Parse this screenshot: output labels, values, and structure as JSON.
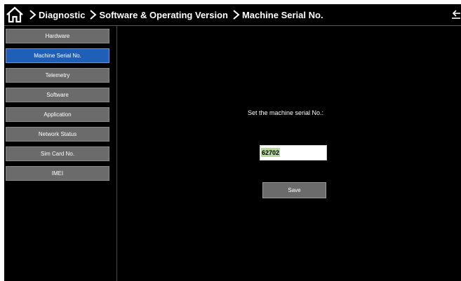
{
  "header": {
    "breadcrumb": [
      "Diagnostic",
      "Software & Operating Version",
      "Machine Serial No."
    ],
    "home_icon": "home-icon",
    "separator_icon": "chevron-right-icon",
    "back_icon": "back-arrow-icon"
  },
  "sidebar": {
    "items": [
      {
        "label": "Hardware",
        "active": false
      },
      {
        "label": "Machine Serial No.",
        "active": true
      },
      {
        "label": "Telemetry",
        "active": false
      },
      {
        "label": "Software",
        "active": false
      },
      {
        "label": "Application",
        "active": false
      },
      {
        "label": "Network Status",
        "active": false
      },
      {
        "label": "Sim Card No.",
        "active": false
      },
      {
        "label": "IMEI",
        "active": false
      }
    ]
  },
  "main": {
    "prompt": "Set the machine serial No.:",
    "serial_value": "62702",
    "save_label": "Save"
  },
  "colors": {
    "background": "#000000",
    "button": "#6b6b6b",
    "active": "#1f5fb8",
    "highlight": "#b8d9a0"
  }
}
